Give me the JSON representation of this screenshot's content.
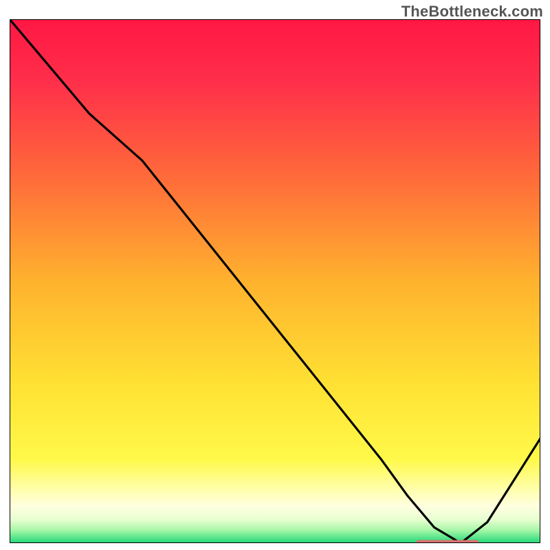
{
  "watermark": "TheBottleneck.com",
  "colors": {
    "gradient_stops": [
      {
        "offset": 0.0,
        "color": "#ff1744"
      },
      {
        "offset": 0.12,
        "color": "#ff2f4a"
      },
      {
        "offset": 0.3,
        "color": "#ff6a3a"
      },
      {
        "offset": 0.5,
        "color": "#ffb22e"
      },
      {
        "offset": 0.7,
        "color": "#ffe233"
      },
      {
        "offset": 0.84,
        "color": "#fff94a"
      },
      {
        "offset": 0.9,
        "color": "#ffffb0"
      },
      {
        "offset": 0.93,
        "color": "#ffffe0"
      },
      {
        "offset": 0.955,
        "color": "#e8ffd0"
      },
      {
        "offset": 0.975,
        "color": "#a8f7a8"
      },
      {
        "offset": 1.0,
        "color": "#1fd877"
      }
    ],
    "curve": "#000000",
    "marker": "#d97070",
    "border": "#000000"
  },
  "chart_data": {
    "type": "line",
    "title": "",
    "xlabel": "",
    "ylabel": "",
    "xlim": [
      0,
      100
    ],
    "ylim": [
      0,
      100
    ],
    "x": [
      0,
      5,
      15,
      25,
      40,
      55,
      70,
      75,
      80,
      85,
      90,
      95,
      100
    ],
    "values": [
      100,
      94,
      82,
      73,
      54,
      35,
      16,
      9,
      3,
      0,
      4,
      12,
      20
    ],
    "flat_band": {
      "x_start": 77,
      "x_end": 88,
      "y": 0.2
    },
    "gradient_axis": "y",
    "gradient_meaning": "red=high bottleneck, green=low bottleneck"
  }
}
